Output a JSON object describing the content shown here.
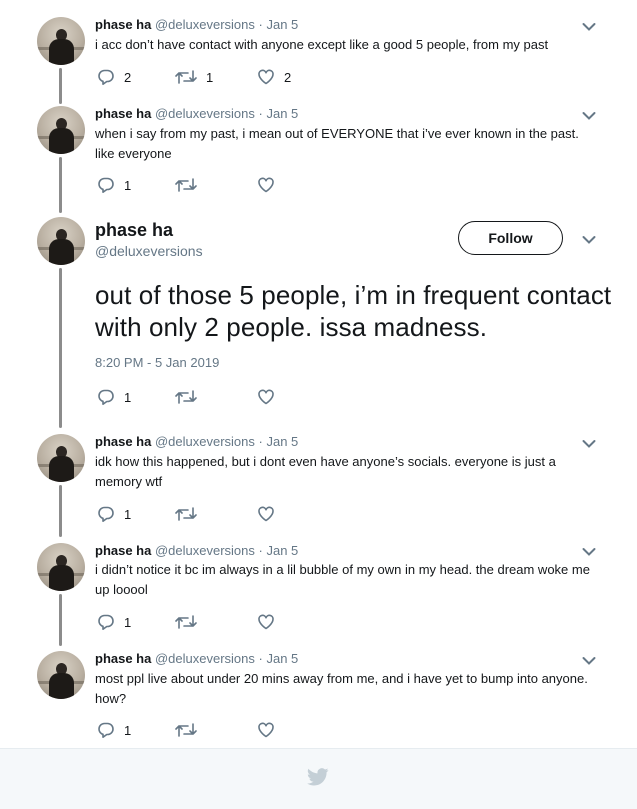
{
  "author": {
    "name": "phase ha",
    "handle": "@deluxeversions"
  },
  "tweets": [
    {
      "meta": " · Jan 5",
      "text": "i acc don’t have contact with anyone except like a good 5 people, from my past",
      "replies": "2",
      "retweets": "1",
      "likes": "2"
    },
    {
      "meta": " · Jan 5",
      "text": "when i say from my past, i mean out of EVERYONE that i’ve ever known in the past. like everyone",
      "replies": "1",
      "retweets": "",
      "likes": ""
    },
    {
      "meta": " · Jan 5",
      "text": "idk how this happened, but i dont even have anyone’s socials. everyone is just a memory wtf",
      "replies": "1",
      "retweets": "",
      "likes": ""
    },
    {
      "meta": " · Jan 5",
      "text": "i didn’t notice it bc im always in a lil bubble of my own in my head. the dream woke me up looool",
      "replies": "1",
      "retweets": "",
      "likes": ""
    },
    {
      "meta": " · Jan 5",
      "text": "most ppl live about under 20 mins away from me, and i have yet to bump into anyone. how?",
      "replies": "1",
      "retweets": "",
      "likes": ""
    }
  ],
  "main_tweet": {
    "follow_label": "Follow",
    "text": "out of those 5 people, i’m in frequent contact with only 2 people. issa madness.",
    "timestamp": "8:20 PM - 5 Jan 2019",
    "replies": "1",
    "retweets": "",
    "likes": ""
  },
  "colors": {
    "text": "#14171a",
    "secondary": "#657786",
    "thread_line": "#8c8c8c",
    "footer_bg": "#f5f8fa",
    "bird": "#c4cfd6"
  },
  "icons": {
    "reply": "reply-icon",
    "retweet": "retweet-icon",
    "like": "heart-icon",
    "menu": "chevron-down-icon",
    "logo": "twitter-bird-icon"
  }
}
